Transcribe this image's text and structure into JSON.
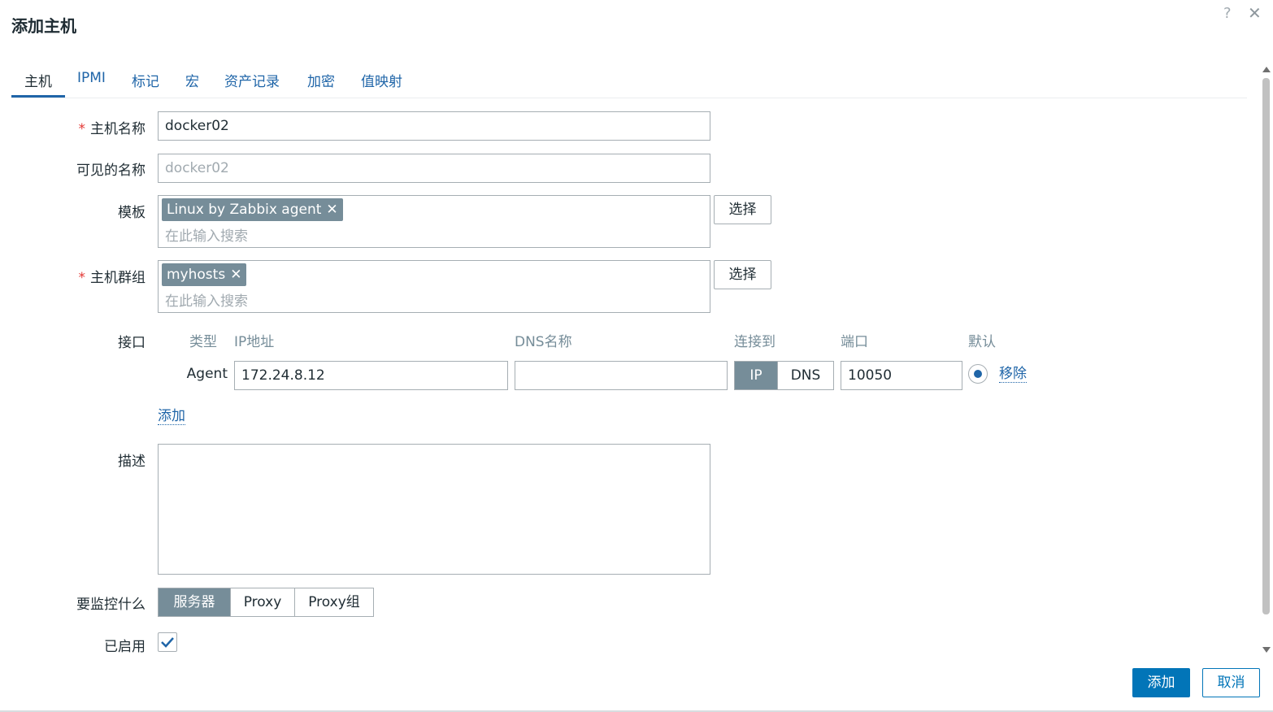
{
  "dialog": {
    "title": "添加主机",
    "help_icon": "?",
    "close_icon": "✕"
  },
  "tabs": [
    {
      "label": "主机",
      "active": true
    },
    {
      "label": "IPMI"
    },
    {
      "label": "标记"
    },
    {
      "label": "宏"
    },
    {
      "label": "资产记录"
    },
    {
      "label": "加密"
    },
    {
      "label": "值映射"
    }
  ],
  "form": {
    "required_mark": "*",
    "host_name": {
      "label": "主机名称",
      "value": "docker02"
    },
    "visible_name": {
      "label": "可见的名称",
      "placeholder": "docker02"
    },
    "templates": {
      "label": "模板",
      "chips": [
        "Linux by Zabbix agent"
      ],
      "placeholder": "在此输入搜索",
      "select_label": "选择"
    },
    "host_groups": {
      "label": "主机群组",
      "chips": [
        "myhosts"
      ],
      "placeholder": "在此输入搜索",
      "select_label": "选择"
    },
    "interfaces": {
      "label": "接口",
      "headers": {
        "type": "类型",
        "ip": "IP地址",
        "dns": "DNS名称",
        "connect": "连接到",
        "port": "端口",
        "default": "默认"
      },
      "rows": [
        {
          "type": "Agent",
          "ip": "172.24.8.12",
          "dns": "",
          "connect_options": [
            "IP",
            "DNS"
          ],
          "connect_selected": "IP",
          "port": "10050",
          "default": true,
          "remove_label": "移除"
        }
      ],
      "add_label": "添加"
    },
    "description": {
      "label": "描述",
      "value": ""
    },
    "monitored_by": {
      "label": "要监控什么",
      "options": [
        "服务器",
        "Proxy",
        "Proxy组"
      ],
      "selected": "服务器"
    },
    "enabled": {
      "label": "已启用",
      "checked": true
    }
  },
  "footer": {
    "add_label": "添加",
    "cancel_label": "取消"
  },
  "colors": {
    "accent": "#0275b8",
    "link": "#1f65a8",
    "chip": "#768d99",
    "required": "#e33734"
  },
  "icons": {
    "chip_remove": "✕",
    "close": "close-icon",
    "help": "help-icon",
    "check": "checkmark-icon"
  }
}
